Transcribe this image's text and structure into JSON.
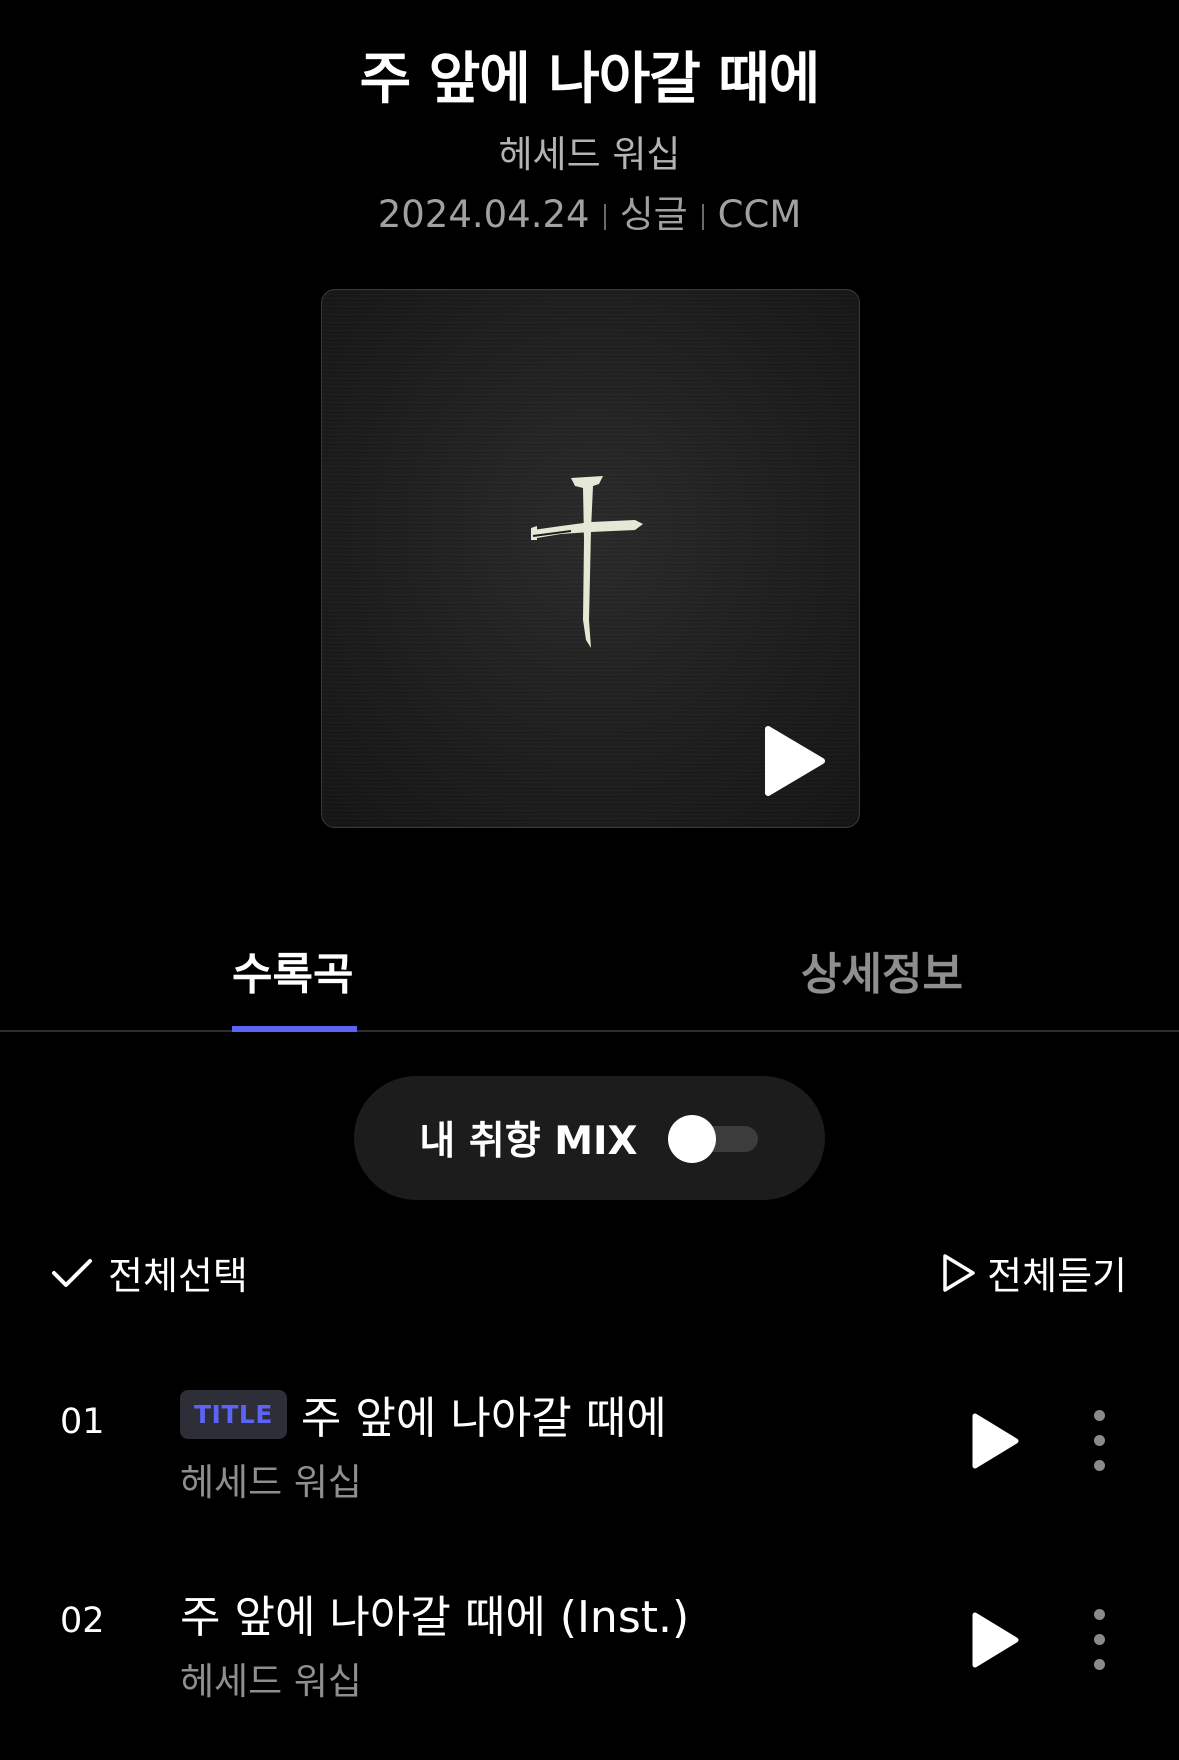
{
  "album": {
    "title": "주 앞에 나아갈 때에",
    "artist": "헤세드 워십",
    "release_date": "2024.04.24",
    "type": "싱글",
    "genre": "CCM"
  },
  "tabs": [
    {
      "label": "수록곡",
      "active": true
    },
    {
      "label": "상세정보",
      "active": false
    }
  ],
  "mix": {
    "label": "내 취향 MIX",
    "enabled": false
  },
  "controls": {
    "select_all": "전체선택",
    "play_all": "전체듣기"
  },
  "tracks": [
    {
      "number": "01",
      "badge": "TITLE",
      "title": "주 앞에 나아갈 때에",
      "artist": "헤세드 워십"
    },
    {
      "number": "02",
      "badge": "",
      "title": "주 앞에 나아갈 때에 (Inst.)",
      "artist": "헤세드 워십"
    }
  ],
  "colors": {
    "accent": "#5b64f5",
    "background": "#000000",
    "muted_text": "#8e8e8e"
  }
}
